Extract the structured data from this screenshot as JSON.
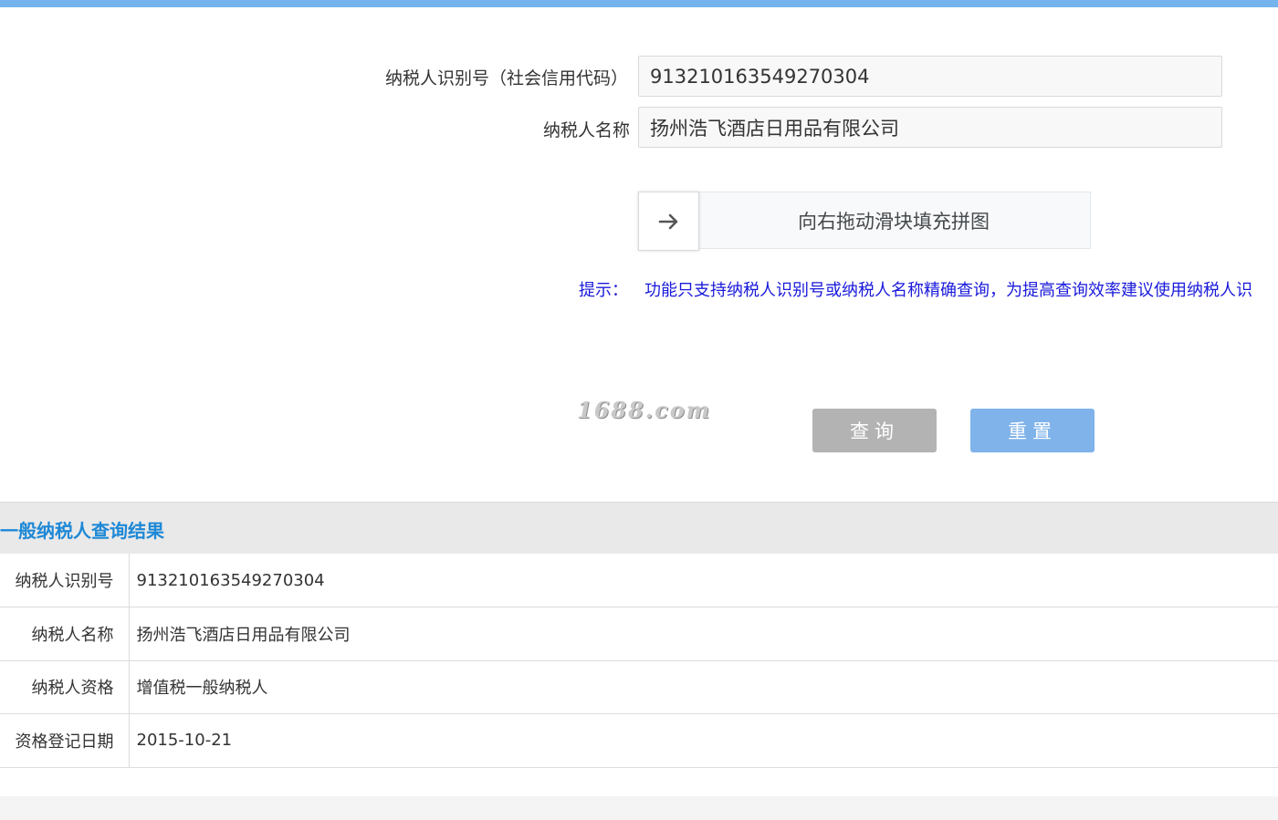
{
  "colors": {
    "top_bar": "#74b3ec",
    "hint_text": "#1a1adb",
    "result_title": "#1e88d6",
    "query_button": "#b3b3b3",
    "reset_button": "#7fb3ea"
  },
  "form": {
    "taxpayer_id_label": "纳税人识别号（社会信用代码）",
    "taxpayer_id_value": "913210163549270304",
    "taxpayer_name_label": "纳税人名称",
    "taxpayer_name_value": "扬州浩飞酒店日用品有限公司"
  },
  "slider": {
    "handle_icon": "arrow-right-icon",
    "handle_glyph": "→",
    "text": "向右拖动滑块填充拼图"
  },
  "hint": {
    "label": "提示：",
    "text": "功能只支持纳税人识别号或纳税人名称精确查询，为提高查询效率建议使用纳税人识"
  },
  "watermark": "1688.com",
  "buttons": {
    "query": "查询",
    "reset": "重置"
  },
  "result": {
    "title": "一般纳税人查询结果",
    "rows": [
      {
        "key": "纳税人识别号",
        "value": "913210163549270304"
      },
      {
        "key": "纳税人名称",
        "value": "扬州浩飞酒店日用品有限公司"
      },
      {
        "key": "纳税人资格",
        "value": "增值税一般纳税人"
      },
      {
        "key": "资格登记日期",
        "value": "2015-10-21"
      }
    ]
  }
}
